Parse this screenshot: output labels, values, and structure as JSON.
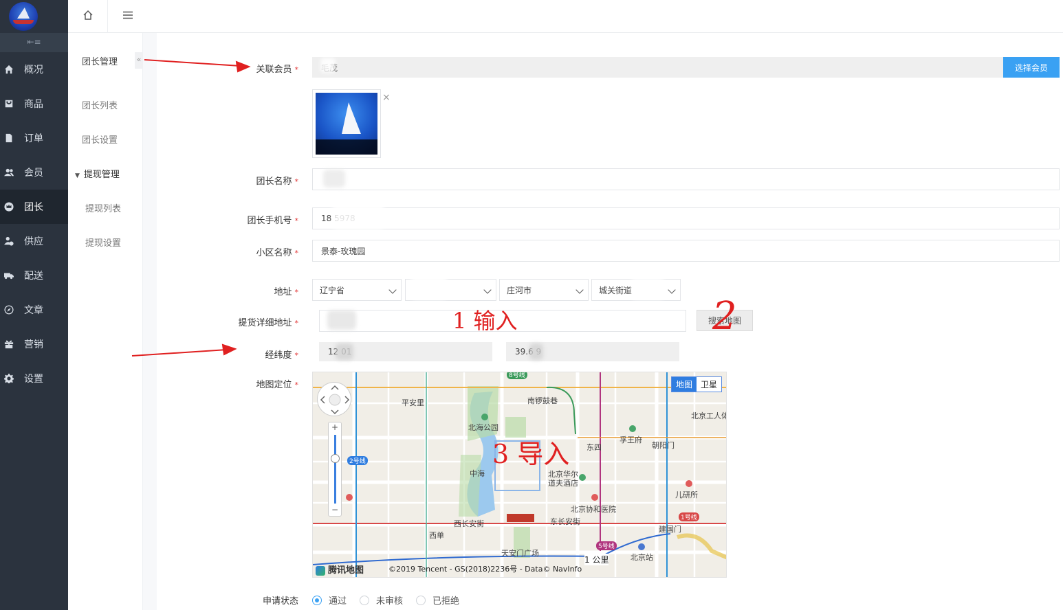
{
  "sidebar": {
    "items": [
      {
        "label": "概况",
        "icon": "home-icon"
      },
      {
        "label": "商品",
        "icon": "goods-icon"
      },
      {
        "label": "订单",
        "icon": "order-icon"
      },
      {
        "label": "会员",
        "icon": "member-icon"
      },
      {
        "label": "团长",
        "icon": "crown-icon",
        "active": true
      },
      {
        "label": "供应",
        "icon": "supplier-icon"
      },
      {
        "label": "配送",
        "icon": "truck-icon"
      },
      {
        "label": "文章",
        "icon": "compass-icon"
      },
      {
        "label": "营销",
        "icon": "gift-icon"
      },
      {
        "label": "设置",
        "icon": "gear-icon"
      }
    ],
    "collapse_glyph": "⇤≡"
  },
  "subnav": {
    "title": "团长管理",
    "items": [
      "团长列表",
      "团长设置"
    ],
    "group": "提现管理",
    "group_items": [
      "提现列表",
      "提现设置"
    ],
    "collapse_glyph": "«"
  },
  "form": {
    "member_label": "关联会员",
    "member_value": "毛茂",
    "select_member_button": "选择会员",
    "remove_glyph": "×",
    "name_label": "团长名称",
    "name_value": "",
    "phone_label": "团长手机号",
    "phone_value": "18       5978",
    "community_label": "小区名称",
    "community_value": "景泰-玫瑰园",
    "address_label": "地址",
    "province": "辽宁省",
    "city": "",
    "district": "庄河市",
    "street": "城关街道",
    "detail_label": "提货详细地址",
    "detail_value": "",
    "search_map_button": "搜索地图",
    "coords_label": "经纬度",
    "longitude": "12    01",
    "latitude": "39.6    9",
    "map_label": "地图定位",
    "status_label": "申请状态",
    "status_options": [
      {
        "label": "通过",
        "checked": true
      },
      {
        "label": "未审核",
        "checked": false
      },
      {
        "label": "已拒绝",
        "checked": false
      }
    ],
    "required_mark": "*"
  },
  "map": {
    "mode_map": "地图",
    "mode_satellite": "卫星",
    "brand": "腾讯地图",
    "copyright": "©2019 Tencent - GS(2018)2236号 - Data© NavInfo",
    "scale": "1 公里",
    "labels": [
      "平安里",
      "南锣鼓巷",
      "北海公园",
      "北京工人体",
      "孚王府",
      "朝阳门",
      "东四",
      "中海",
      "北京华尔道夫酒店",
      "北京协和医院",
      "儿研所",
      "西长安街",
      "东长安街",
      "西单",
      "天安门广场",
      "建国门",
      "北京站",
      "2号线",
      "1号线",
      "5号线",
      "8号线"
    ]
  },
  "annotations": {
    "step1": "1 输入",
    "step2": "2",
    "step3": "3 导入"
  },
  "colors": {
    "sidebar": "#2b333e",
    "accent": "#3aa1f3",
    "required": "#e23b3b",
    "annotation": "#e02020"
  }
}
